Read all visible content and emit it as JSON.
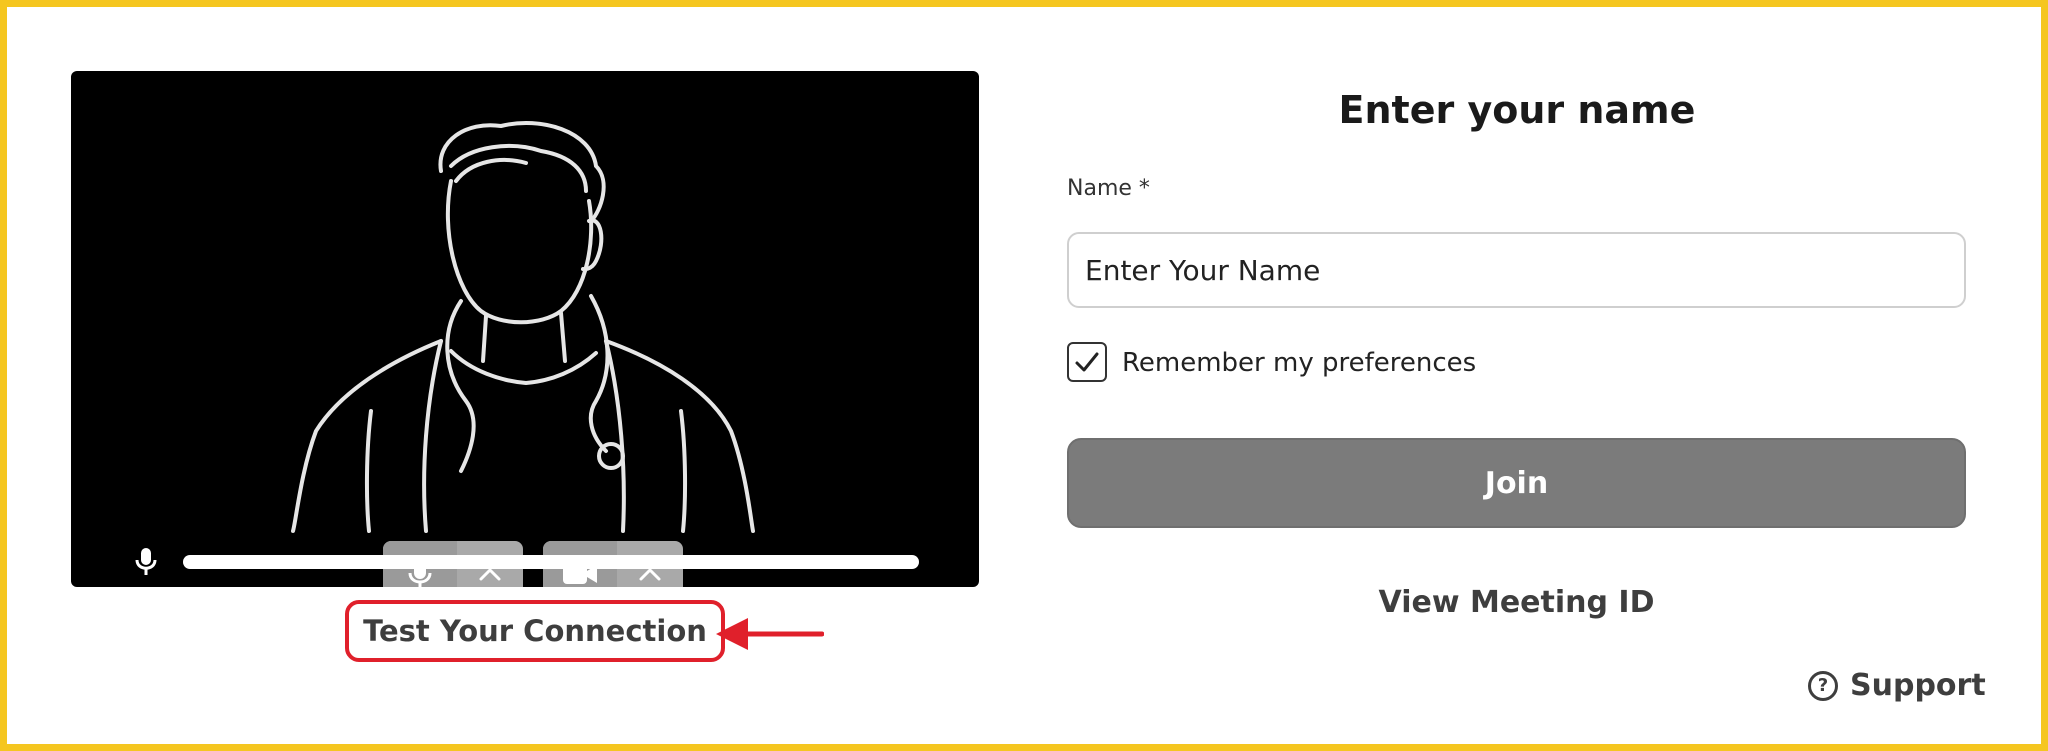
{
  "form": {
    "title": "Enter your name",
    "name_label": "Name *",
    "name_placeholder": "Enter Your Name",
    "remember_label": "Remember my preferences",
    "remember_checked": true,
    "join_label": "Join",
    "meeting_id_link": "View Meeting ID"
  },
  "preview": {
    "test_connection_label": "Test Your Connection",
    "mic_level": 0,
    "controls": [
      "microphone-icon",
      "chevron-up-icon",
      "camera-icon",
      "chevron-up-icon"
    ]
  },
  "support": {
    "label": "Support",
    "icon": "question-circle-icon"
  },
  "colors": {
    "frame": "#f5c61f",
    "annotation": "#e0202b",
    "join_button": "#7b7b7b"
  }
}
